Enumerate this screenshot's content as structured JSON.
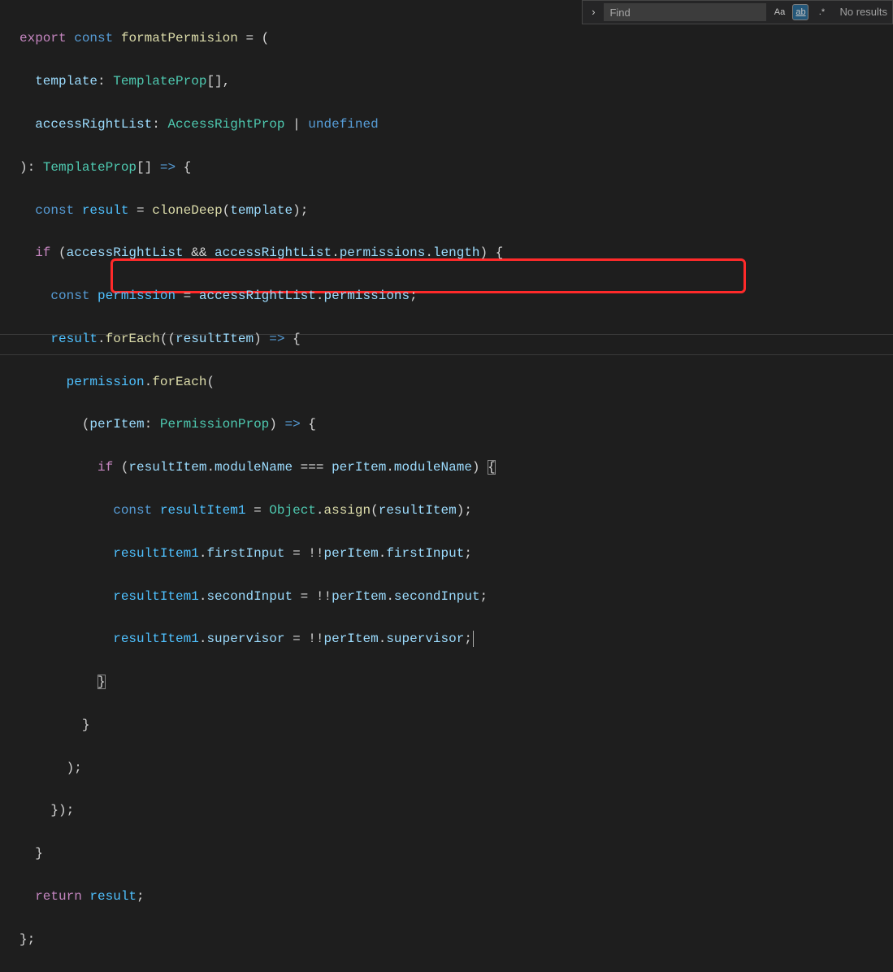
{
  "find": {
    "placeholder": "Find",
    "value": "",
    "matchCase": "Aa",
    "wholeWord": "ab",
    "regex": ".*",
    "results": "No results"
  },
  "code": {
    "l1": {
      "a": "export",
      "b": "const",
      "c": "formatPermision",
      "d": " = ("
    },
    "l2": {
      "a": "template",
      "b": ": ",
      "c": "TemplateProp",
      "d": "[],"
    },
    "l3": {
      "a": "accessRightList",
      "b": ": ",
      "c": "AccessRightProp",
      "d": " | ",
      "e": "undefined"
    },
    "l4": {
      "a": "): ",
      "b": "TemplateProp",
      "c": "[] ",
      "d": "=>",
      "e": " {"
    },
    "l5": {
      "a": "const",
      "b": "result",
      "c": " = ",
      "d": "cloneDeep",
      "e": "(",
      "f": "template",
      "g": ");"
    },
    "l6": {
      "a": "if",
      "b": " (",
      "c": "accessRightList",
      "d": " && ",
      "e": "accessRightList",
      "f": ".",
      "g": "permissions",
      "h": ".",
      "i": "length",
      "j": ") {"
    },
    "l7": {
      "a": "const",
      "b": "permission",
      "c": " = ",
      "d": "accessRightList",
      "e": ".",
      "f": "permissions",
      "g": ";"
    },
    "l8": {
      "a": "result",
      "b": ".",
      "c": "forEach",
      "d": "((",
      "e": "resultItem",
      "f": ") ",
      "g": "=>",
      "h": " {"
    },
    "l9": {
      "a": "permission",
      "b": ".",
      "c": "forEach",
      "d": "("
    },
    "l10": {
      "a": "(",
      "b": "perItem",
      "c": ": ",
      "d": "PermissionProp",
      "e": ") ",
      "f": "=>",
      "g": " {"
    },
    "l11": {
      "a": "if",
      "b": " (",
      "c": "resultItem",
      "d": ".",
      "e": "moduleName",
      "f": " === ",
      "g": "perItem",
      "h": ".",
      "i": "moduleName",
      "j": ") ",
      "k": "{"
    },
    "l12": {
      "a": "const",
      "b": "resultItem1",
      "c": " = ",
      "d": "Object",
      "e": ".",
      "f": "assign",
      "g": "(",
      "h": "resultItem",
      "i": ");"
    },
    "l13": {
      "a": "resultItem1",
      "b": ".",
      "c": "firstInput",
      "d": " = !!",
      "e": "perItem",
      "f": ".",
      "g": "firstInput",
      "h": ";"
    },
    "l14": {
      "a": "resultItem1",
      "b": ".",
      "c": "secondInput",
      "d": " = !!",
      "e": "perItem",
      "f": ".",
      "g": "secondInput",
      "h": ";"
    },
    "l15": {
      "a": "resultItem1",
      "b": ".",
      "c": "supervisor",
      "d": " = !!",
      "e": "perItem",
      "f": ".",
      "g": "supervisor",
      "h": ";"
    },
    "l16": {
      "a": "}"
    },
    "l17": {
      "a": "}"
    },
    "l18": {
      "a": ");"
    },
    "l19": {
      "a": "});"
    },
    "l20": {
      "a": "}"
    },
    "l21": {
      "a": "return",
      "b": "result",
      "c": ";"
    },
    "l22": {
      "a": "};"
    }
  }
}
